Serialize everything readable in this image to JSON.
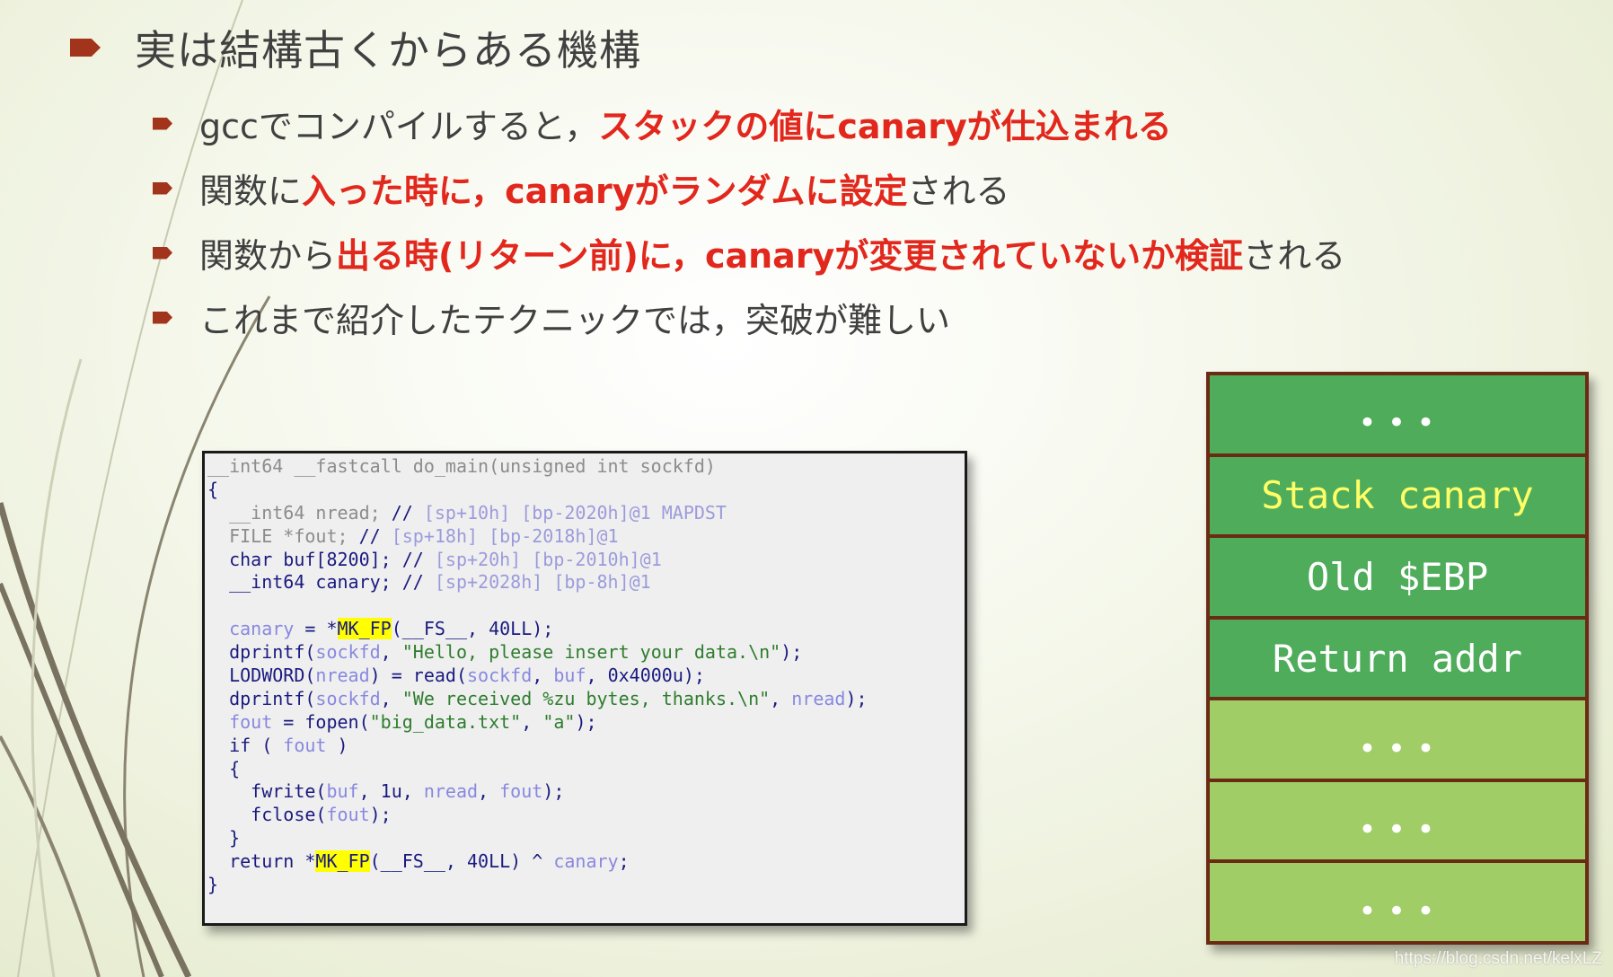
{
  "slide": {
    "title": "実は結構古くからある機構",
    "bullets": [
      {
        "parts": [
          {
            "text": "gccでコンパイルすると，",
            "highlight": false
          },
          {
            "text": "スタックの値にcanaryが仕込まれる",
            "highlight": true
          }
        ]
      },
      {
        "parts": [
          {
            "text": "関数に",
            "highlight": false
          },
          {
            "text": "入った時に，canaryがランダムに設定",
            "highlight": true
          },
          {
            "text": "される",
            "highlight": false
          }
        ]
      },
      {
        "parts": [
          {
            "text": "関数から",
            "highlight": false
          },
          {
            "text": "出る時(リターン前)に，canaryが変更されていないか検証",
            "highlight": true
          },
          {
            "text": "される",
            "highlight": false
          }
        ]
      },
      {
        "parts": [
          {
            "text": "これまで紹介したテクニックでは，突破が難しい",
            "highlight": false
          }
        ]
      }
    ],
    "colors": {
      "bullet_arrow": "#a3341c",
      "highlight_text": "#e2271d",
      "body_text": "#404040"
    }
  },
  "code": {
    "lines": [
      [
        {
          "t": "__int64 __fastcall do_main(unsigned int sockfd)",
          "c": "c-gray"
        }
      ],
      [
        {
          "t": "{",
          "c": "c-navy"
        }
      ],
      [
        {
          "t": "  __int64 nread; ",
          "c": "c-gray"
        },
        {
          "t": "// ",
          "c": "c-navy"
        },
        {
          "t": "[sp+10h] [bp-2020h]@1 MAPDST",
          "c": "c-cmt"
        }
      ],
      [
        {
          "t": "  FILE *fout; ",
          "c": "c-gray"
        },
        {
          "t": "// ",
          "c": "c-navy"
        },
        {
          "t": "[sp+18h] [bp-2018h]@1",
          "c": "c-cmt"
        }
      ],
      [
        {
          "t": "  char buf[8200]; ",
          "c": "c-navy"
        },
        {
          "t": "// ",
          "c": "c-navy"
        },
        {
          "t": "[sp+20h] [bp-2010h]@1",
          "c": "c-cmt"
        }
      ],
      [
        {
          "t": "  __int64 canary; ",
          "c": "c-navy"
        },
        {
          "t": "// ",
          "c": "c-navy"
        },
        {
          "t": "[sp+2028h] [bp-8h]@1",
          "c": "c-cmt"
        }
      ],
      [
        {
          "t": "",
          "c": "c-navy"
        }
      ],
      [
        {
          "t": "  ",
          "c": "c-navy"
        },
        {
          "t": "canary",
          "c": "c-var"
        },
        {
          "t": " = *",
          "c": "c-navy"
        },
        {
          "t": "MK_FP",
          "c": "c-hl"
        },
        {
          "t": "(__FS__, 40LL);",
          "c": "c-navy"
        }
      ],
      [
        {
          "t": "  dprintf(",
          "c": "c-navy"
        },
        {
          "t": "sockfd",
          "c": "c-var"
        },
        {
          "t": ", ",
          "c": "c-navy"
        },
        {
          "t": "\"Hello, please insert your data.\\n\"",
          "c": "c-str"
        },
        {
          "t": ");",
          "c": "c-navy"
        }
      ],
      [
        {
          "t": "  LODWORD(",
          "c": "c-navy"
        },
        {
          "t": "nread",
          "c": "c-var"
        },
        {
          "t": ") = read(",
          "c": "c-navy"
        },
        {
          "t": "sockfd",
          "c": "c-var"
        },
        {
          "t": ", ",
          "c": "c-navy"
        },
        {
          "t": "buf",
          "c": "c-var"
        },
        {
          "t": ", 0x4000u);",
          "c": "c-navy"
        }
      ],
      [
        {
          "t": "  dprintf(",
          "c": "c-navy"
        },
        {
          "t": "sockfd",
          "c": "c-var"
        },
        {
          "t": ", ",
          "c": "c-navy"
        },
        {
          "t": "\"We received %zu bytes, thanks.\\n\"",
          "c": "c-str"
        },
        {
          "t": ", ",
          "c": "c-navy"
        },
        {
          "t": "nread",
          "c": "c-var"
        },
        {
          "t": ");",
          "c": "c-navy"
        }
      ],
      [
        {
          "t": "  ",
          "c": "c-navy"
        },
        {
          "t": "fout",
          "c": "c-var"
        },
        {
          "t": " = fopen(",
          "c": "c-navy"
        },
        {
          "t": "\"big_data.txt\"",
          "c": "c-str"
        },
        {
          "t": ", ",
          "c": "c-navy"
        },
        {
          "t": "\"a\"",
          "c": "c-str"
        },
        {
          "t": ");",
          "c": "c-navy"
        }
      ],
      [
        {
          "t": "  if ( ",
          "c": "c-navy"
        },
        {
          "t": "fout",
          "c": "c-var"
        },
        {
          "t": " )",
          "c": "c-navy"
        }
      ],
      [
        {
          "t": "  {",
          "c": "c-navy"
        }
      ],
      [
        {
          "t": "    fwrite(",
          "c": "c-navy"
        },
        {
          "t": "buf",
          "c": "c-var"
        },
        {
          "t": ", 1u, ",
          "c": "c-navy"
        },
        {
          "t": "nread",
          "c": "c-var"
        },
        {
          "t": ", ",
          "c": "c-navy"
        },
        {
          "t": "fout",
          "c": "c-var"
        },
        {
          "t": ");",
          "c": "c-navy"
        }
      ],
      [
        {
          "t": "    fclose(",
          "c": "c-navy"
        },
        {
          "t": "fout",
          "c": "c-var"
        },
        {
          "t": ");",
          "c": "c-navy"
        }
      ],
      [
        {
          "t": "  }",
          "c": "c-navy"
        }
      ],
      [
        {
          "t": "  return *",
          "c": "c-navy"
        },
        {
          "t": "MK_FP",
          "c": "c-hl"
        },
        {
          "t": "(__FS__, 40LL) ^ ",
          "c": "c-navy"
        },
        {
          "t": "canary",
          "c": "c-var"
        },
        {
          "t": ";",
          "c": "c-navy"
        }
      ],
      [
        {
          "t": "}",
          "c": "c-navy"
        }
      ]
    ]
  },
  "stack": {
    "cells": [
      {
        "label": "...",
        "style": "dark",
        "dots": true
      },
      {
        "label": "Stack canary",
        "style": "dark",
        "yellow": true
      },
      {
        "label": "Old $EBP",
        "style": "dark"
      },
      {
        "label": "Return addr",
        "style": "dark"
      },
      {
        "label": "...",
        "style": "light",
        "dots": true
      },
      {
        "label": "...",
        "style": "light",
        "dots": true
      },
      {
        "label": "...",
        "style": "light",
        "dots": true
      }
    ],
    "colors": {
      "frame": "#6b2a14",
      "dark_cell": "#4fac5b",
      "light_cell": "#a1cd66",
      "canary_text": "#ffff66"
    }
  },
  "watermark": "https://blog.csdn.net/kelxLZ"
}
